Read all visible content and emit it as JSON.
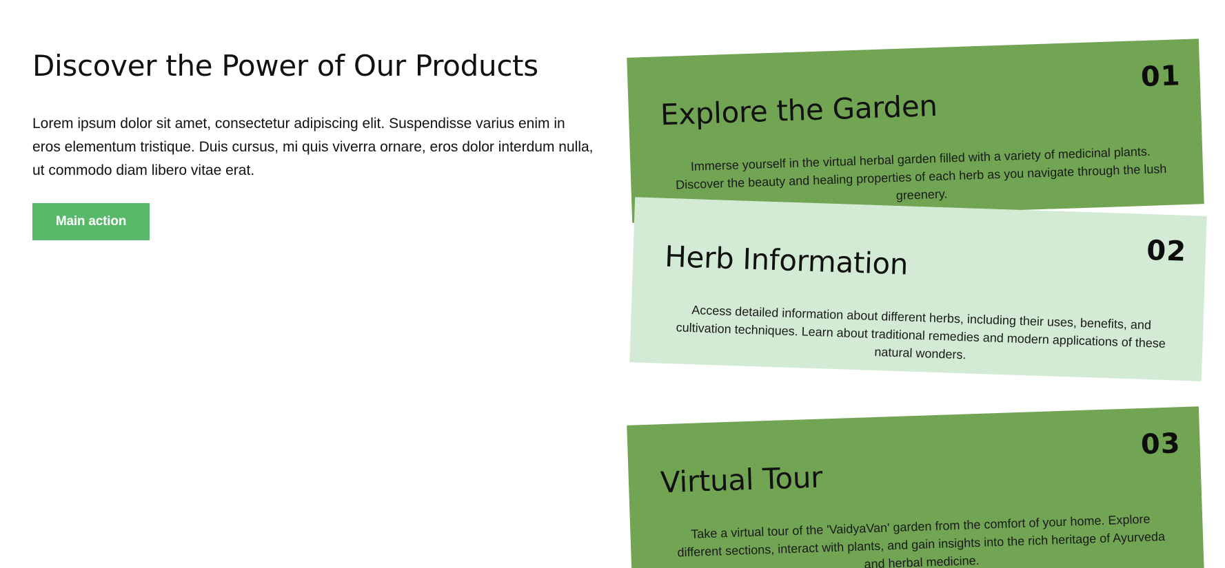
{
  "hero": {
    "title": "Discover the Power of Our Products",
    "description": "Lorem ipsum dolor sit amet, consectetur adipiscing elit. Suspendisse varius enim in eros elementum tristique. Duis cursus, mi quis viverra ornare, eros dolor interdum nulla, ut commodo diam libero vitae erat.",
    "button_label": "Main action"
  },
  "cards": [
    {
      "number": "01",
      "title": "Explore the Garden",
      "text": "Immerse yourself in the virtual herbal garden filled with a variety of medicinal plants. Discover the beauty and healing properties of each herb as you navigate through the lush greenery."
    },
    {
      "number": "02",
      "title": "Herb Information",
      "text": "Access detailed information about different herbs, including their uses, benefits, and cultivation techniques. Learn about traditional remedies and modern applications of these natural wonders."
    },
    {
      "number": "03",
      "title": "Virtual Tour",
      "text": "Take a virtual tour of the 'VaidyaVan' garden from the comfort of your home. Explore different sections, interact with plants, and gain insights into the rich heritage of Ayurveda and herbal medicine."
    }
  ],
  "colors": {
    "accent_button": "#57b86a",
    "card_dark": "#71a554",
    "card_light": "#d3ebd4"
  }
}
